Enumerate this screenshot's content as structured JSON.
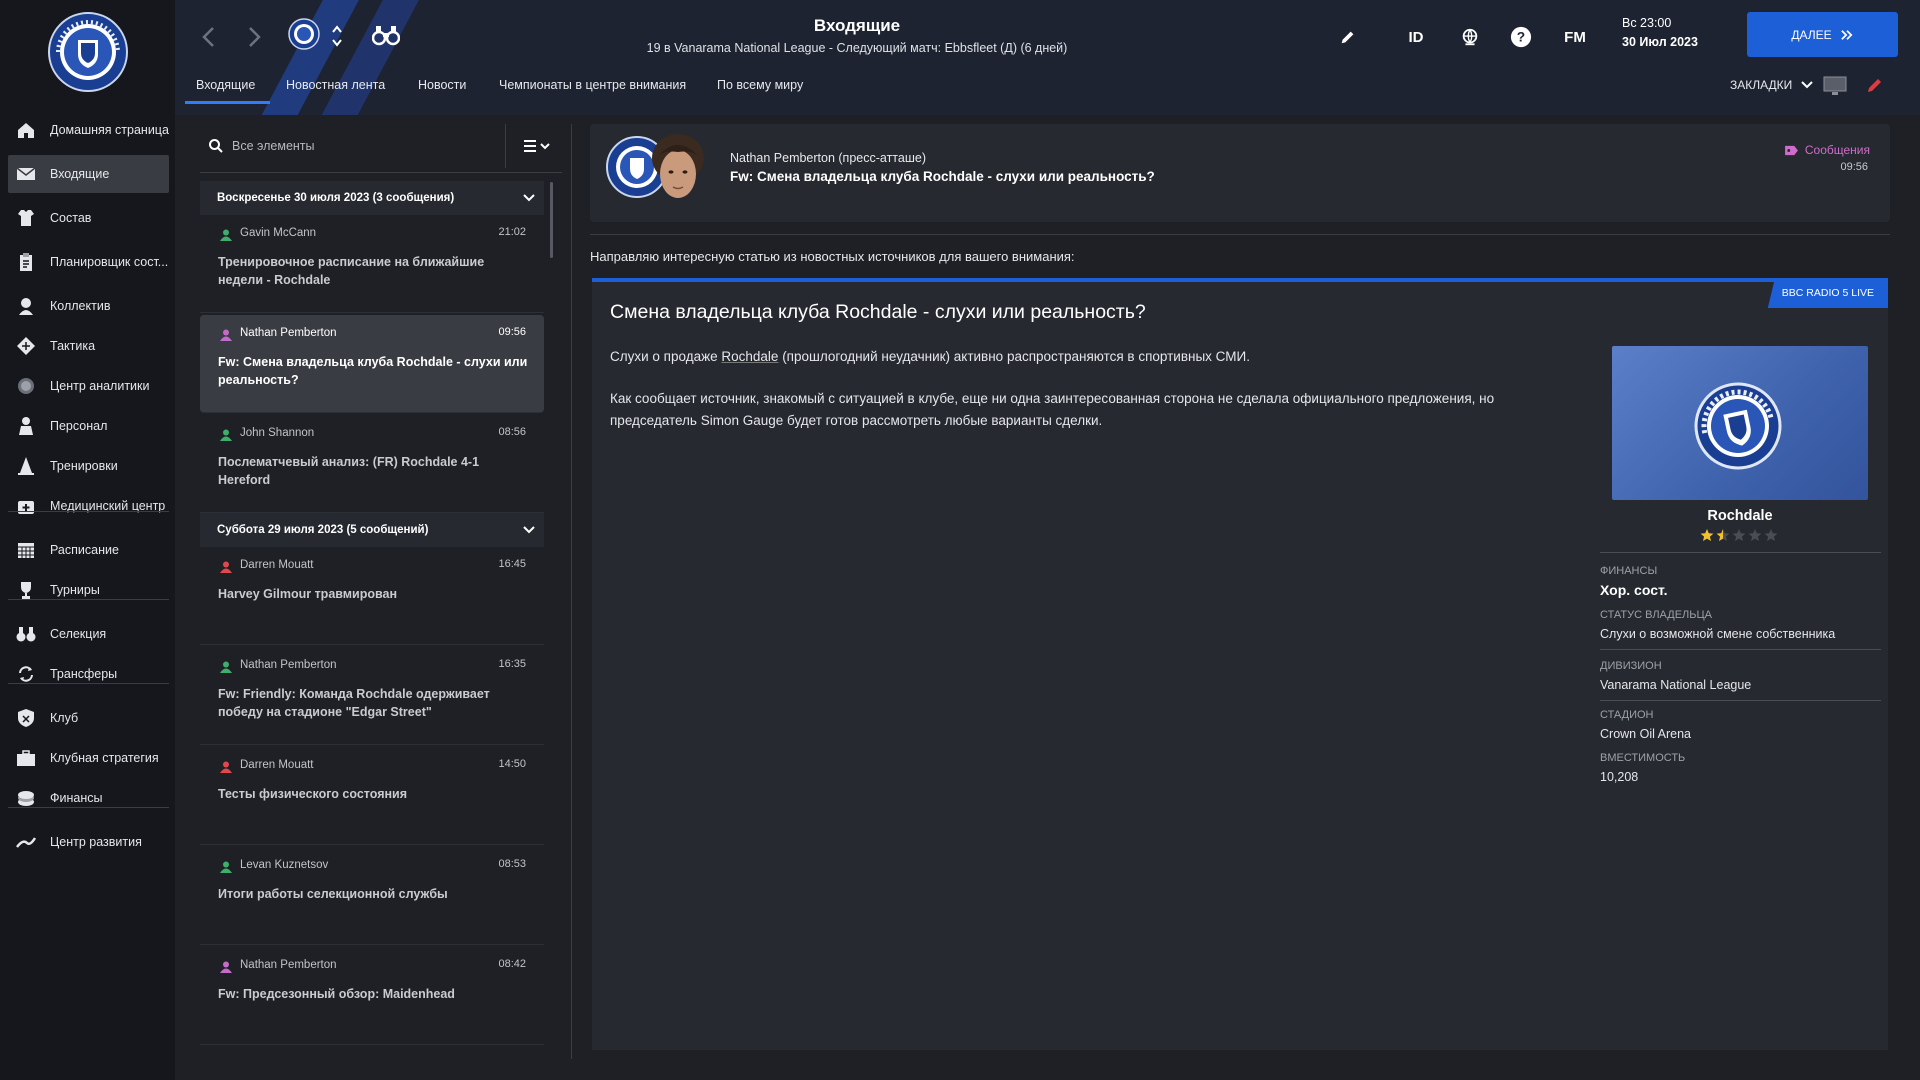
{
  "sidebar": {
    "items": [
      {
        "label": "Домашняя страница",
        "icon": "home-icon"
      },
      {
        "label": "Входящие",
        "icon": "envelope-icon"
      },
      {
        "label": "Состав",
        "icon": "shirt-icon"
      },
      {
        "label": "Планировщик сост...",
        "icon": "clipboard-icon"
      },
      {
        "label": "Коллектив",
        "icon": "group-icon"
      },
      {
        "label": "Тактика",
        "icon": "tactics-icon"
      },
      {
        "label": "Центр аналитики",
        "icon": "analytics-icon"
      },
      {
        "label": "Персонал",
        "icon": "staff-icon"
      },
      {
        "label": "Тренировки",
        "icon": "cone-icon"
      },
      {
        "label": "Медицинский центр",
        "icon": "medical-icon"
      },
      {
        "label": "Расписание",
        "icon": "calendar-icon"
      },
      {
        "label": "Турниры",
        "icon": "trophy-icon"
      },
      {
        "label": "Селекция",
        "icon": "binoculars-icon"
      },
      {
        "label": "Трансферы",
        "icon": "transfer-icon"
      },
      {
        "label": "Клуб",
        "icon": "club-shield-icon"
      },
      {
        "label": "Клубная стратегия",
        "icon": "briefcase-icon"
      },
      {
        "label": "Финансы",
        "icon": "money-icon"
      },
      {
        "label": "Центр развития",
        "icon": "development-icon"
      }
    ]
  },
  "header": {
    "title": "Входящие",
    "subtitle": "19 в Vanarama National League - Следующий матч: Ebbsfleet (Д) (6 дней)",
    "toolbar_icons": {
      "edit": "pencil-icon",
      "id": "ID",
      "world": "globe-icon",
      "help": "?",
      "fm": "FM"
    },
    "date_line1": "Вс 23:00",
    "date_line2": "30 Июл 2023",
    "continue_label": "ДАЛЕЕ",
    "tabs": [
      "Входящие",
      "Новостная лента",
      "Новости",
      "Чемпионаты в центре внимания",
      "По всему миру"
    ],
    "bookmarks_label": "ЗАКЛАДКИ"
  },
  "inbox": {
    "search_placeholder": "Все элементы",
    "groups": [
      {
        "title": "Воскресенье 30 июля 2023 (3 сообщения)",
        "messages": [
          {
            "sender": "Gavin McCann",
            "time": "21:02",
            "subject": "Тренировочное расписание на ближайшие недели - Rochdale",
            "icon_color": "#3fae6a"
          },
          {
            "sender": "Nathan Pemberton",
            "time": "09:56",
            "subject": "Fw: Смена владельца клуба Rochdale - слухи или реальность?",
            "icon_color": "#c56ac9"
          },
          {
            "sender": "John Shannon",
            "time": "08:56",
            "subject": "Послематчевый анализ: (FR) Rochdale 4-1 Hereford",
            "icon_color": "#3fae6a"
          }
        ]
      },
      {
        "title": "Суббота 29 июля 2023 (5 сообщений)",
        "messages": [
          {
            "sender": "Darren Mouatt",
            "time": "16:45",
            "subject": "Harvey Gilmour травмирован",
            "icon_color": "#e0484c"
          },
          {
            "sender": "Nathan Pemberton",
            "time": "16:35",
            "subject": "Fw: Friendly: Команда Rochdale одерживает победу на стадионе \"Edgar Street\"",
            "icon_color": "#3fae6a"
          },
          {
            "sender": "Darren Mouatt",
            "time": "14:50",
            "subject": "Тесты физического состояния",
            "icon_color": "#e0484c"
          },
          {
            "sender": "Levan Kuznetsov",
            "time": "08:53",
            "subject": "Итоги работы селекционной службы",
            "icon_color": "#3fae6a"
          },
          {
            "sender": "Nathan Pemberton",
            "time": "08:42",
            "subject": "Fw: Предсезонный обзор: Maidenhead",
            "icon_color": "#c56ac9"
          }
        ]
      }
    ]
  },
  "message": {
    "from": "Nathan Pemberton  (пресс-атташе)",
    "subject": "Fw: Смена владельца клуба Rochdale - слухи или реальность?",
    "category": "Сообщения",
    "time": "09:56",
    "intro": "Направляю интересную статью из новостных источников для вашего внимания:",
    "article": {
      "source": "BBC RADIO 5 LIVE",
      "title": "Смена владельца клуба Rochdale - слухи или реальность?",
      "p1_before": "Слухи о продаже ",
      "p1_link": "Rochdale",
      "p1_after": " (прошлогодний неудачник) активно распространяются в спортивных СМИ.",
      "p2_before": "Как сообщает источник, знакомый с ситуацией в клубе, еще ни одна заинтересованная сторона не сделала официального предложения, но председатель ",
      "p2_link": "Simon Gauge",
      "p2_after": " будет готов рассмотреть любые варианты сделки."
    },
    "club": {
      "name": "Rochdale",
      "badge_text_top": "ROCHDALE A.F.C.",
      "badge_text_bottom": "THE DALE",
      "stars": 1.5,
      "stars_max": 5,
      "finances_label": "ФИНАНСЫ",
      "finances_value": "Хор. сост.",
      "ownership_label": "СТАТУС ВЛАДЕЛЬЦА",
      "ownership_value": "Слухи о возможной смене собственника",
      "division_label": "ДИВИЗИОН",
      "division_value": "Vanarama National League",
      "stadium_label": "СТАДИОН",
      "stadium_value": "Crown Oil Arena",
      "capacity_label": "ВМЕСТИМОСТЬ",
      "capacity_value": "10,208"
    }
  },
  "colors": {
    "accent": "#1c5fd6",
    "category": "#d06ccc",
    "star": "#f2c12e"
  }
}
